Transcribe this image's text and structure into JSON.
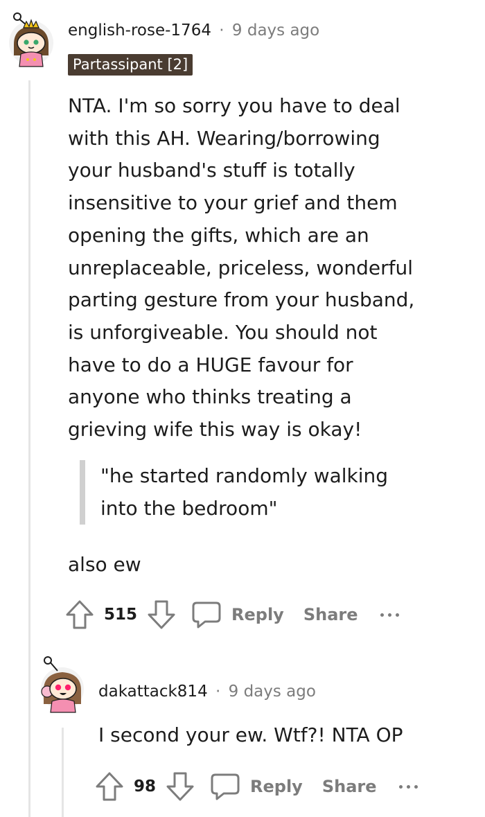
{
  "comments": [
    {
      "username": "english-rose-1764",
      "separator": "·",
      "time": "9 days ago",
      "flair": "Partassipant [2]",
      "body_lines": [
        "NTA. I'm so sorry you have to deal",
        "with this AH. Wearing/borrowing",
        "your husband's stuff is totally",
        "insensitive to your grief and them",
        "opening the gifts, which are an",
        "unreplaceable, priceless, wonderful",
        "parting gesture from your husband,",
        "is unforgiveable. You should not",
        "have to do a HUGE favour for",
        "anyone who thinks treating a",
        "grieving wife this way is okay!"
      ],
      "quote_lines": [
        "\"he started randomly walking",
        "into the bedroom\""
      ],
      "after_quote": "also ew",
      "votes": "515",
      "reply_label": "Reply",
      "share_label": "Share"
    },
    {
      "username": "dakattack814",
      "separator": "·",
      "time": "9 days ago",
      "body_lines": [
        "I second your ew. Wtf?! NTA OP"
      ],
      "votes": "98",
      "reply_label": "Reply",
      "share_label": "Share"
    }
  ],
  "icons": {
    "upvote": "upvote-arrow-icon",
    "downvote": "downvote-arrow-icon",
    "reply": "speech-bubble-icon",
    "more": "more-dots-icon"
  },
  "colors": {
    "meta_text": "#7c7c7c",
    "flair_bg": "#4a3c31",
    "thread_line": "#e5e5e5"
  }
}
